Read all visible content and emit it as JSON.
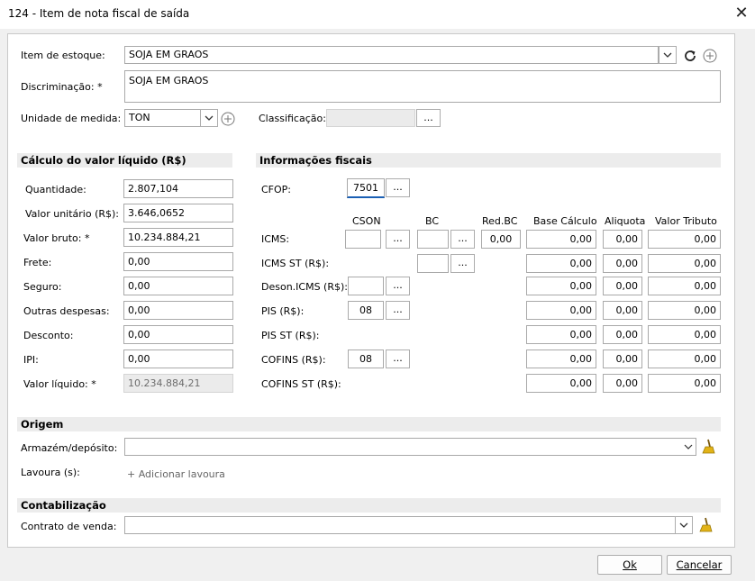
{
  "window": {
    "title": "124 - Item de nota fiscal de saída"
  },
  "top": {
    "item_estoque_label": "Item de estoque:",
    "item_estoque_value": "SOJA EM GRAOS",
    "discriminacao_label": "Discriminação: *",
    "discriminacao_value": "SOJA EM GRAOS",
    "unidade_label": "Unidade de medida: *",
    "unidade_value": "TON",
    "classificacao_label": "Classificação:",
    "classificacao_value": ""
  },
  "calc": {
    "title": "Cálculo do valor líquido (R$)",
    "rows": [
      {
        "label": "Quantidade:",
        "value": "2.807,104"
      },
      {
        "label": "Valor unitário (R$):",
        "value": "3.646,0652"
      },
      {
        "label": "Valor bruto: *",
        "value": "10.234.884,21"
      },
      {
        "label": "Frete:",
        "value": "0,00"
      },
      {
        "label": "Seguro:",
        "value": "0,00"
      },
      {
        "label": "Outras despesas:",
        "value": "0,00"
      },
      {
        "label": "Desconto:",
        "value": "0,00"
      },
      {
        "label": "IPI:",
        "value": "0,00"
      },
      {
        "label": "Valor líquido: *",
        "value": "10.234.884,21"
      }
    ]
  },
  "fiscal": {
    "title": "Informações fiscais",
    "cfop_label": "CFOP:",
    "cfop_value": "7501",
    "headers": {
      "cson": "CSON",
      "bc": "BC",
      "redbc": "Red.BC",
      "base": "Base Cálculo",
      "aliquota": "Aliquota",
      "valor": "Valor Tributo"
    },
    "rows": [
      {
        "label": "ICMS:",
        "cson": "",
        "bc": "",
        "redbc": "0,00",
        "base": "0,00",
        "aliquota": "0,00",
        "valor": "0,00"
      },
      {
        "label": "ICMS ST (R$):",
        "bc": "",
        "base": "0,00",
        "aliquota": "0,00",
        "valor": "0,00"
      },
      {
        "label": "Deson.ICMS (R$):",
        "cson": "",
        "base": "0,00",
        "aliquota": "0,00",
        "valor": "0,00"
      },
      {
        "label": "PIS (R$):",
        "cson": "08",
        "base": "0,00",
        "aliquota": "0,00",
        "valor": "0,00"
      },
      {
        "label": "PIS ST (R$):",
        "base": "0,00",
        "aliquota": "0,00",
        "valor": "0,00"
      },
      {
        "label": "COFINS (R$):",
        "cson": "08",
        "base": "0,00",
        "aliquota": "0,00",
        "valor": "0,00"
      },
      {
        "label": "COFINS ST (R$):",
        "base": "0,00",
        "aliquota": "0,00",
        "valor": "0,00"
      }
    ]
  },
  "origem": {
    "title": "Origem",
    "armazem_label": "Armazém/depósito:",
    "armazem_value": "",
    "lavoura_label": "Lavoura (s):",
    "add_lavoura": "+ Adicionar lavoura"
  },
  "contab": {
    "title": "Contabilização",
    "contrato_label": "Contrato de venda:",
    "contrato_value": ""
  },
  "buttons": {
    "ellipsis": "...",
    "ok": "Ok",
    "cancel": "Cancelar"
  },
  "icons": {
    "refresh": "refresh-icon",
    "add": "add-circle-icon",
    "clear": "broom-icon",
    "close": "close-icon",
    "dropdown": "chevron-down-icon"
  }
}
